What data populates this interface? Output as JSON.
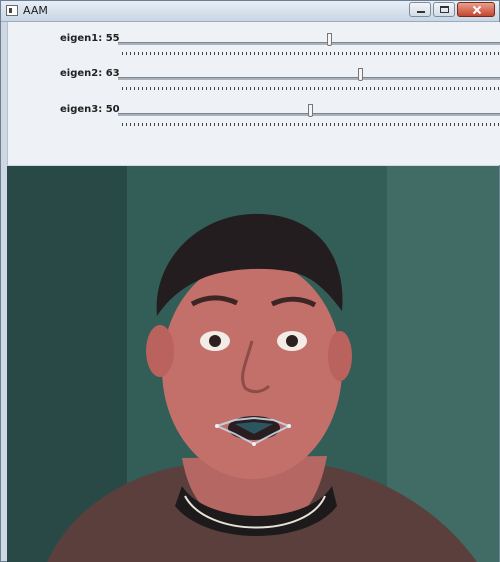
{
  "window": {
    "title": "AAM"
  },
  "trackbars": [
    {
      "label": "eigen1: 55",
      "value": 55,
      "max": 100
    },
    {
      "label": "eigen2: 63",
      "value": 63,
      "max": 100
    },
    {
      "label": "eigen3: 50",
      "value": 50,
      "max": 100
    }
  ],
  "image": {
    "subject": "webcam face with active appearance model lip landmarks"
  }
}
